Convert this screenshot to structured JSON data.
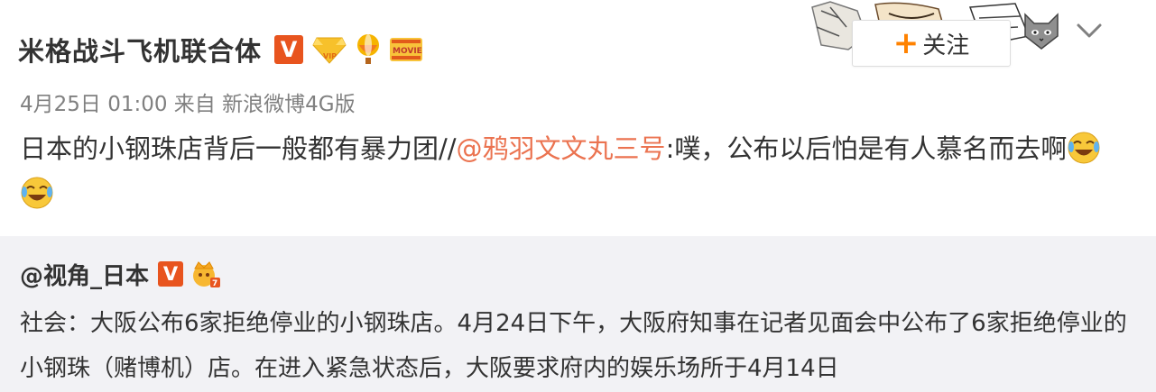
{
  "post": {
    "author": "米格战斗飞机联合体",
    "badges": [
      "V",
      "VIP",
      "balloon",
      "MOVIE"
    ],
    "meta": "4月25日 01:00 来自 新浪微博4G版",
    "content_before_mention": "日本的小钢珠店背后一般都有暴力团//",
    "mention": "@鸦羽文文丸三号",
    "content_after_mention": ":噗，公布以后怕是有人慕名而去啊",
    "emojis": [
      "laugh-cry-emoji",
      "laugh-cry-emoji"
    ]
  },
  "follow_button": {
    "plus": "+",
    "label": "关注"
  },
  "menu": {
    "icon": "chevron-down-icon"
  },
  "repost": {
    "author": "@视角_日本",
    "badges": [
      "V",
      "crown"
    ],
    "text": "社会：大阪公布6家拒绝停业的小钢珠店。4月24日下午，大阪府知事在记者见面会中公布了6家拒绝停业的 小钢珠（赌博机）店。在进入紧急状态后，大阪要求府内的娱乐场所于4月14日"
  },
  "colors": {
    "mention": "#eb7350",
    "follow_plus": "#ff8200",
    "verified": "#e8541e",
    "repost_bg": "#f2f2f5"
  }
}
